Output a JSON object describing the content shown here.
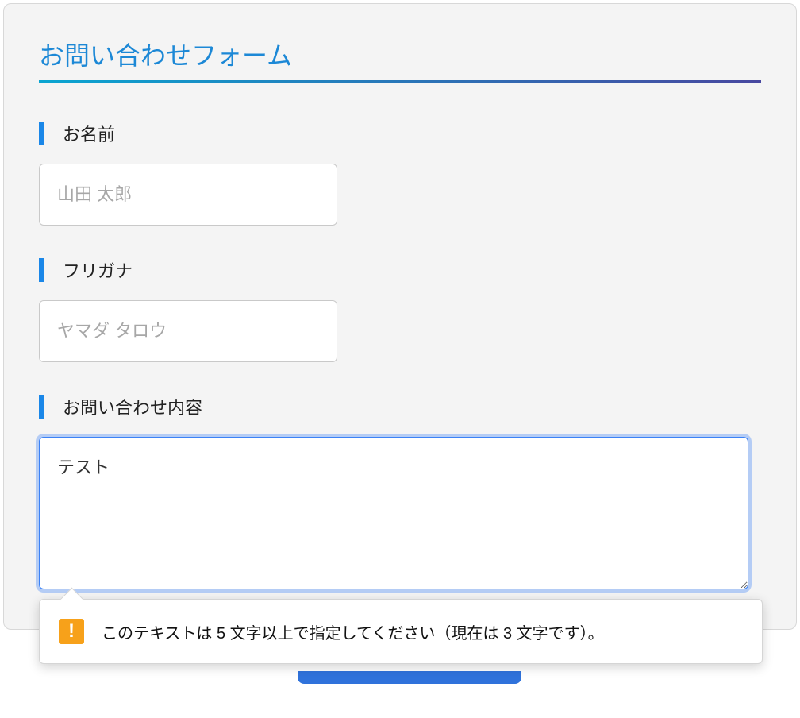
{
  "form": {
    "title": "お問い合わせフォーム",
    "name": {
      "label": "お名前",
      "placeholder": "山田 太郎",
      "value": ""
    },
    "furigana": {
      "label": "フリガナ",
      "placeholder": "ヤマダ タロウ",
      "value": ""
    },
    "inquiry": {
      "label": "お問い合わせ内容",
      "value": "テスト"
    },
    "validation": {
      "icon": "!",
      "message": "このテキストは 5 文字以上で指定してください（現在は 3 文字です）。"
    }
  }
}
